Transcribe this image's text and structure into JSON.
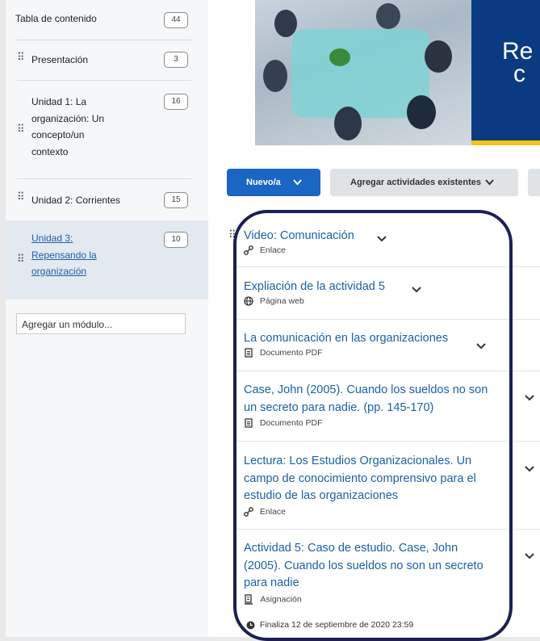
{
  "sidebar": {
    "toc": {
      "label": "Tabla de contenido",
      "count": "44"
    },
    "items": [
      {
        "label": "Presentación",
        "count": "3"
      },
      {
        "label_lines": [
          "Unidad 1: La",
          "organización: Un",
          "concepto/un",
          "contexto"
        ],
        "count": "16"
      },
      {
        "label": "Unidad 2: Corrientes",
        "count": "15"
      },
      {
        "label_lines": [
          "Unidad 3:",
          "Repensando la",
          "organización"
        ],
        "count": "10",
        "active": true
      }
    ],
    "add_module_placeholder": "Agregar un módulo..."
  },
  "banner": {
    "text_line1": "Re",
    "text_line2": "c"
  },
  "toolbar": {
    "new_label": "Nuevo/a",
    "existing_label": "Agregar actividades existentes"
  },
  "content": {
    "items": [
      {
        "title_lines": [
          "Video: Comunicación"
        ],
        "type": "Enlace",
        "icon": "link-icon"
      },
      {
        "title_lines": [
          "Expliación de la actividad 5"
        ],
        "type": "Página web",
        "icon": "globe-icon"
      },
      {
        "title_lines": [
          "La comunicación en las organizaciones"
        ],
        "type": "Documento PDF",
        "icon": "document-icon"
      },
      {
        "title_lines": [
          "Case, John (2005). Cuando los sueldos no son",
          "un secreto para nadie. (pp. 145-170)"
        ],
        "type": "Documento PDF",
        "icon": "document-icon"
      },
      {
        "title_lines": [
          "Lectura: Los Estudios Organizacionales. Un",
          "campo de conocimiento comprensivo para el",
          "estudio de las organizaciones"
        ],
        "type": "Enlace",
        "icon": "link-icon"
      },
      {
        "title_lines": [
          "Actividad 5: Caso de estudio. Case, John",
          "(2005). Cuando los sueldos no son un secreto",
          "para nadie"
        ],
        "type": "Asignación",
        "icon": "assignment-icon"
      }
    ],
    "due_text": "Finaliza 12 de septiembre de 2020 23:59"
  },
  "colors": {
    "link": "#1e5fa8",
    "primary_button": "#1b65c4",
    "banner_navy": "#0a3b82",
    "banner_accent": "#f1c419",
    "outline": "#1d2050"
  }
}
